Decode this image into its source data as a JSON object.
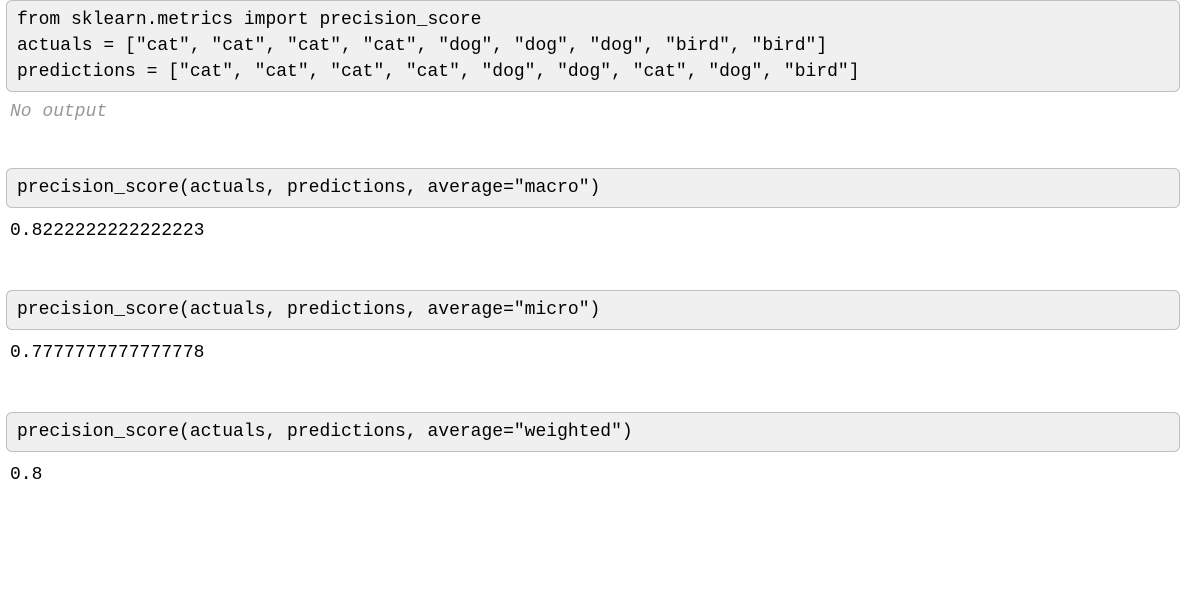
{
  "cells": [
    {
      "code": "from sklearn.metrics import precision_score\nactuals = [\"cat\", \"cat\", \"cat\", \"cat\", \"dog\", \"dog\", \"dog\", \"bird\", \"bird\"]\npredictions = [\"cat\", \"cat\", \"cat\", \"cat\", \"dog\", \"dog\", \"cat\", \"dog\", \"bird\"]",
      "output_type": "none",
      "output": "No output"
    },
    {
      "code": "precision_score(actuals, predictions, average=\"macro\")",
      "output_type": "text",
      "output": "0.8222222222222223"
    },
    {
      "code": "precision_score(actuals, predictions, average=\"micro\")",
      "output_type": "text",
      "output": "0.7777777777777778"
    },
    {
      "code": "precision_score(actuals, predictions, average=\"weighted\")",
      "output_type": "text",
      "output": "0.8"
    }
  ]
}
